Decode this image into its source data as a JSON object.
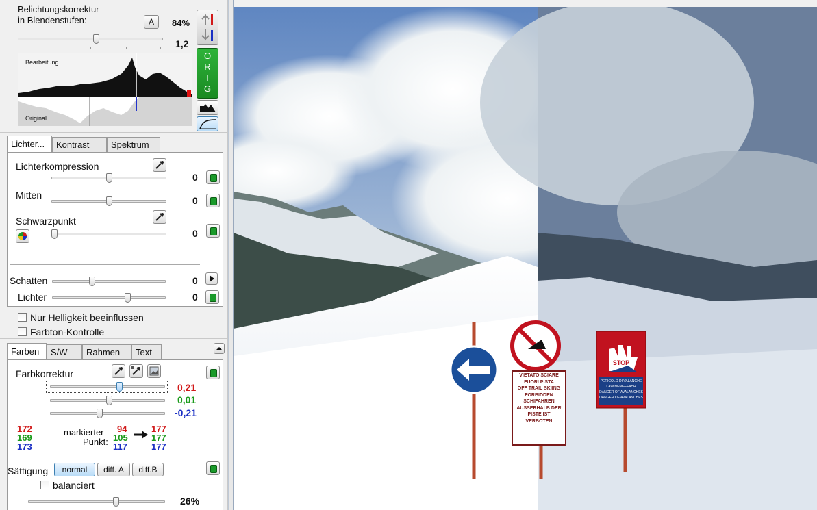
{
  "exposure": {
    "title_line1": "Belichtungskorrektur",
    "title_line2": "in Blendenstufen:",
    "auto_label": "A",
    "percent": "84%",
    "value": "1,2",
    "slider_fraction": 0.5
  },
  "histogram": {
    "top_label": "Bearbeitung",
    "bottom_label": "Original"
  },
  "orig_button": {
    "letters": [
      "O",
      "R",
      "I",
      "G"
    ],
    "color": "#1f9a22"
  },
  "tabs_top": [
    {
      "label": "Lichter...",
      "active": true
    },
    {
      "label": "Kontrast",
      "active": false
    },
    {
      "label": "Spektrum",
      "active": false
    }
  ],
  "lichter": {
    "compression_label": "Lichterkompression",
    "compression_value": "0",
    "mitten_label": "Mitten",
    "mitten_value": "0",
    "schwarz_label": "Schwarzpunkt",
    "schwarz_value": "0"
  },
  "shadows": {
    "schatten_label": "Schatten",
    "schatten_value": "0",
    "lichter_label": "Lichter",
    "lichter_value": "0"
  },
  "options": {
    "brightness_only": "Nur Helligkeit beeinflussen",
    "hue_control": "Farbton-Kontrolle"
  },
  "tabs_bottom": [
    {
      "label": "Farben",
      "active": true
    },
    {
      "label": "S/W",
      "active": false
    },
    {
      "label": "Rahmen",
      "active": false
    },
    {
      "label": "Text",
      "active": false
    }
  ],
  "farben": {
    "label": "Farbkorrektur",
    "values": [
      "0,21",
      "0,01",
      "-0,21"
    ],
    "slider_fractions": [
      0.58,
      0.5,
      0.42
    ]
  },
  "marked_point": {
    "label_line1": "markierter",
    "label_line2": "Punkt:",
    "left_rgb": [
      "172",
      "169",
      "173"
    ],
    "mid_rgb": [
      "94",
      "105",
      "117"
    ],
    "right_rgb": [
      "177",
      "177",
      "177"
    ]
  },
  "saturation": {
    "label": "Sättigung",
    "modes": [
      "normal",
      "diff. A",
      "diff.B"
    ],
    "selected": "normal",
    "balanced_label": "balanciert",
    "percent": "26%",
    "slider_fraction": 0.6
  },
  "photo": {
    "sign_left_lines": [
      "VIETATO SCIARE",
      "FUORI PISTA",
      "OFF TRAIL SKIING",
      "FORBIDDEN",
      "SCHIFAHREN",
      "AUSSERHALB DER",
      "PISTE IST",
      "VERBOTEN"
    ],
    "sign_right_word": "STOP",
    "sign_right_lines": [
      "PERICOLO DI VALANGHE",
      "LAWINENGEFAHR",
      "DANGER OF AVALANCHES",
      "DANGER OF AVALANCHES"
    ]
  },
  "colors": {
    "red": "#d11a1a",
    "green": "#1a9a1a",
    "blue": "#1a2fc4",
    "accent_green": "#1a9a2a"
  }
}
